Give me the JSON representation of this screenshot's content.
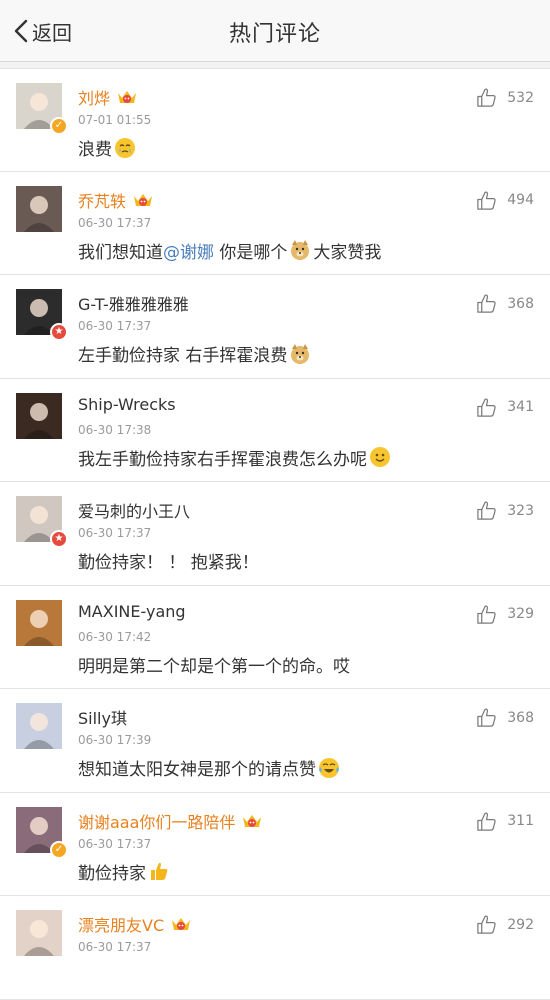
{
  "navbar": {
    "back_label": "返回",
    "title": "热门评论"
  },
  "comments": [
    {
      "name": "刘烨",
      "vip": true,
      "badge": "v",
      "time": "07-01 01:55",
      "text": "浪费",
      "text_after": "",
      "mention": "",
      "emoji": "crying",
      "likes": "532",
      "avatar_color": "#d9d4cc"
    },
    {
      "name": "乔芃轶",
      "vip": true,
      "badge": "",
      "time": "06-30 17:37",
      "text": "我们想知道",
      "mention": "@谢娜",
      "text_after": " 你是哪个",
      "emoji": "doge",
      "text_tail": "大家赞我",
      "likes": "494",
      "avatar_color": "#6a5a54"
    },
    {
      "name": "G-T-雅雅雅雅雅",
      "vip": false,
      "badge": "red",
      "time": "06-30 17:37",
      "text": "左手勤俭持家 右手挥霍浪费",
      "mention": "",
      "text_after": "",
      "emoji": "doge",
      "likes": "368",
      "avatar_color": "#2c2c2c"
    },
    {
      "name": "Ship-Wrecks",
      "vip": false,
      "badge": "",
      "time": "06-30 17:38",
      "text": "我左手勤俭持家右手挥霍浪费怎么办呢",
      "mention": "",
      "text_after": "",
      "emoji": "smile",
      "likes": "341",
      "avatar_color": "#3a2a22"
    },
    {
      "name": "爱马刺的小王八",
      "vip": false,
      "badge": "red",
      "time": "06-30 17:37",
      "text": "勤俭持家！ ！ 抱紧我！",
      "mention": "",
      "text_after": "",
      "emoji": "",
      "likes": "323",
      "avatar_color": "#cfc7c0"
    },
    {
      "name": "MAXINE-yang",
      "vip": false,
      "badge": "",
      "time": "06-30 17:42",
      "text": "明明是第二个却是个第一个的命。哎",
      "mention": "",
      "text_after": "",
      "emoji": "",
      "likes": "329",
      "avatar_color": "#b8783a"
    },
    {
      "name": "Silly琪",
      "vip": false,
      "badge": "",
      "time": "06-30 17:39",
      "text": "想知道太阳女神是那个的请点赞",
      "mention": "",
      "text_after": "",
      "emoji": "laugh-cry",
      "likes": "368",
      "avatar_color": "#c8cfe0"
    },
    {
      "name": "谢谢aaa你们一路陪伴",
      "vip": true,
      "badge": "v",
      "time": "06-30 17:37",
      "text": "勤俭持家",
      "mention": "",
      "text_after": "",
      "emoji": "thumbs-up",
      "likes": "311",
      "avatar_color": "#8a6b7a"
    },
    {
      "name": "漂亮朋友VC",
      "vip": true,
      "badge": "",
      "time": "06-30 17:37",
      "text": "",
      "mention": "",
      "text_after": "",
      "emoji": "",
      "likes": "292",
      "avatar_color": "#e2d2c8"
    }
  ],
  "colors": {
    "vip_name": "#e8811f",
    "mention": "#4a7ebd",
    "badge_v": "#f5a623",
    "badge_red": "#e54b3c"
  }
}
